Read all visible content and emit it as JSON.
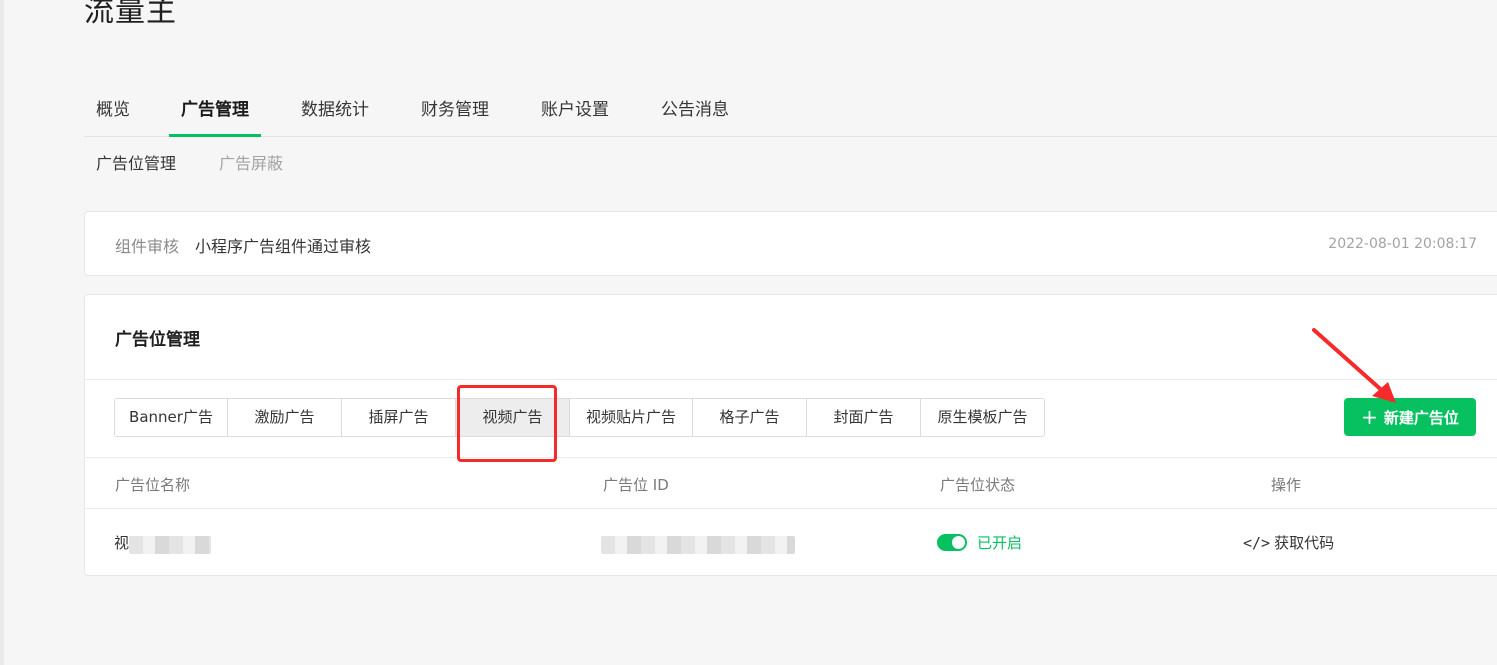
{
  "app": {
    "title": "流量主"
  },
  "main_nav": {
    "tabs": [
      {
        "label": "概览",
        "active": false
      },
      {
        "label": "广告管理",
        "active": true
      },
      {
        "label": "数据统计",
        "active": false
      },
      {
        "label": "财务管理",
        "active": false
      },
      {
        "label": "账户设置",
        "active": false
      },
      {
        "label": "公告消息",
        "active": false
      }
    ]
  },
  "sub_nav": {
    "items": [
      {
        "label": "广告位管理",
        "active": true
      },
      {
        "label": "广告屏蔽",
        "active": false
      }
    ]
  },
  "notice": {
    "label": "组件审核",
    "text": "小程序广告组件通过审核",
    "time": "2022-08-01 20:08:17"
  },
  "panel": {
    "title": "广告位管理",
    "ad_types": [
      {
        "label": "Banner广告",
        "active": false
      },
      {
        "label": "激励广告",
        "active": false
      },
      {
        "label": "插屏广告",
        "active": false
      },
      {
        "label": "视频广告",
        "active": true
      },
      {
        "label": "视频贴片广告",
        "active": false
      },
      {
        "label": "格子广告",
        "active": false
      },
      {
        "label": "封面广告",
        "active": false
      },
      {
        "label": "原生模板广告",
        "active": false
      }
    ],
    "create_button": {
      "icon": "plus-icon",
      "label": "新建广告位"
    }
  },
  "table": {
    "columns": [
      "广告位名称",
      "广告位 ID",
      "广告位状态",
      "操作"
    ],
    "rows": [
      {
        "name_prefix": "视",
        "status": "已开启",
        "action": "获取代码",
        "action_icon": "code-icon"
      }
    ]
  },
  "colors": {
    "accent": "#07c160",
    "annotation_red": "#f52b2b"
  }
}
